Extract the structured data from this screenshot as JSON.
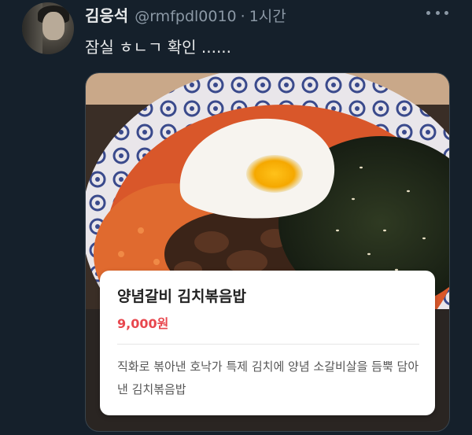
{
  "tweet": {
    "display_name": "김응석",
    "handle": "@rmfpdl0010",
    "separator": "·",
    "time": "1시간",
    "text": "잠실 ㅎㄴㄱ 확인 ......"
  },
  "menu_card": {
    "name": "양념갈비 김치볶음밥",
    "price": "9,000원",
    "description": "직화로 볶아낸 호낙가 특제 김치에 양념 소갈비살을 듬뿍 담아낸 김치볶음밥",
    "price_color": "#e8474e"
  },
  "colors": {
    "background": "#15202b",
    "primary_text": "#e7e9ea",
    "secondary_text": "#8b98a5"
  },
  "icons": {
    "more": "more-horizontal-icon"
  }
}
